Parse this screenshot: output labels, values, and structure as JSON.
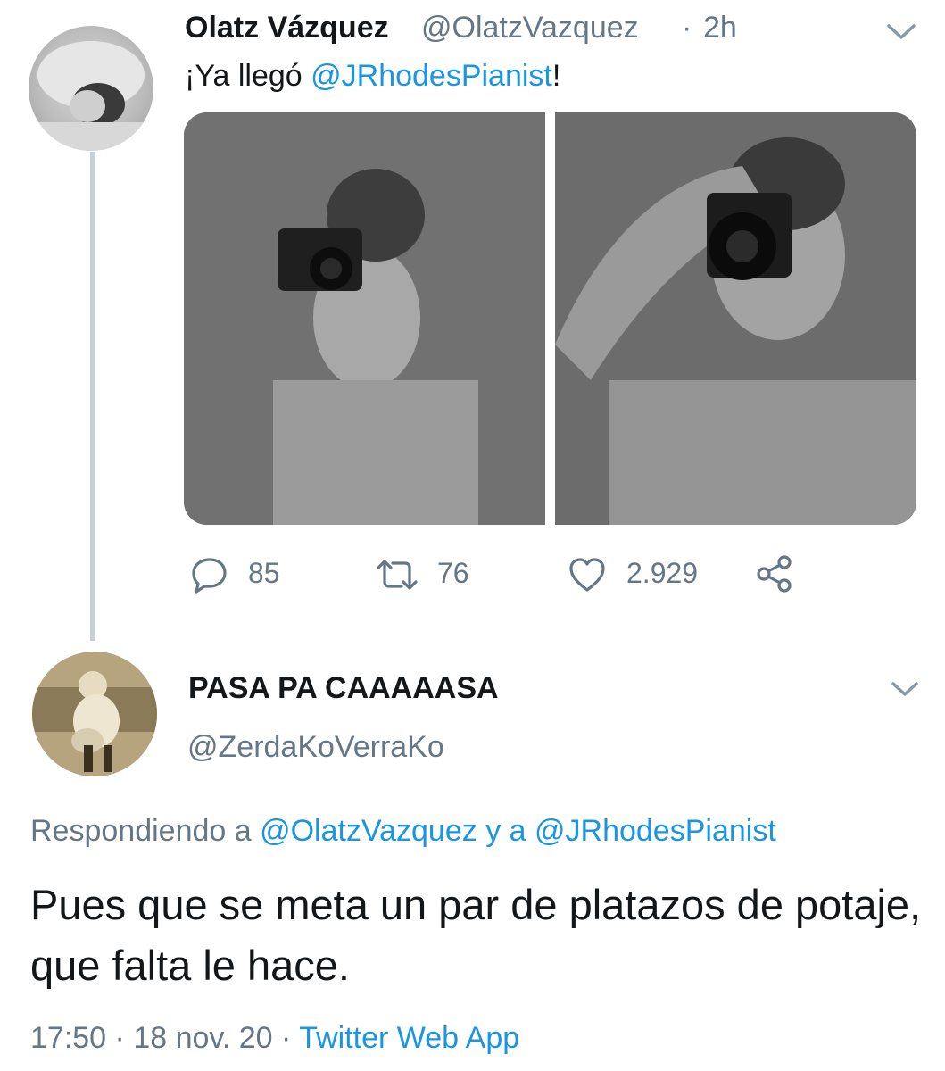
{
  "tweet": {
    "author_name": "Olatz Vázquez",
    "author_handle": "@OlatzVazquez",
    "separator": "·",
    "time_ago": "2h",
    "text_prefix": "¡Ya llegó ",
    "text_mention": "@JRhodesPianist",
    "text_suffix": "!",
    "reply_count": "85",
    "retweet_count": "76",
    "like_count": "2.929"
  },
  "reply": {
    "author_name": "PASA PA CAAAAASA",
    "author_handle": "@ZerdaKoVerraKo",
    "replying_prefix": "Respondiendo a ",
    "replying_mention1": "@OlatzVazquez",
    "replying_join": " y a ",
    "replying_mention2": "@JRhodesPianist",
    "text": "Pues que se meta un par de platazos de potaje, que falta le hace.",
    "time": "17:50",
    "separator1": " · ",
    "date": "18 nov. 20",
    "separator2": " · ",
    "source": "Twitter Web App"
  },
  "icons": [
    "chevron-down-icon",
    "reply-icon",
    "retweet-icon",
    "like-icon",
    "share-icon"
  ]
}
